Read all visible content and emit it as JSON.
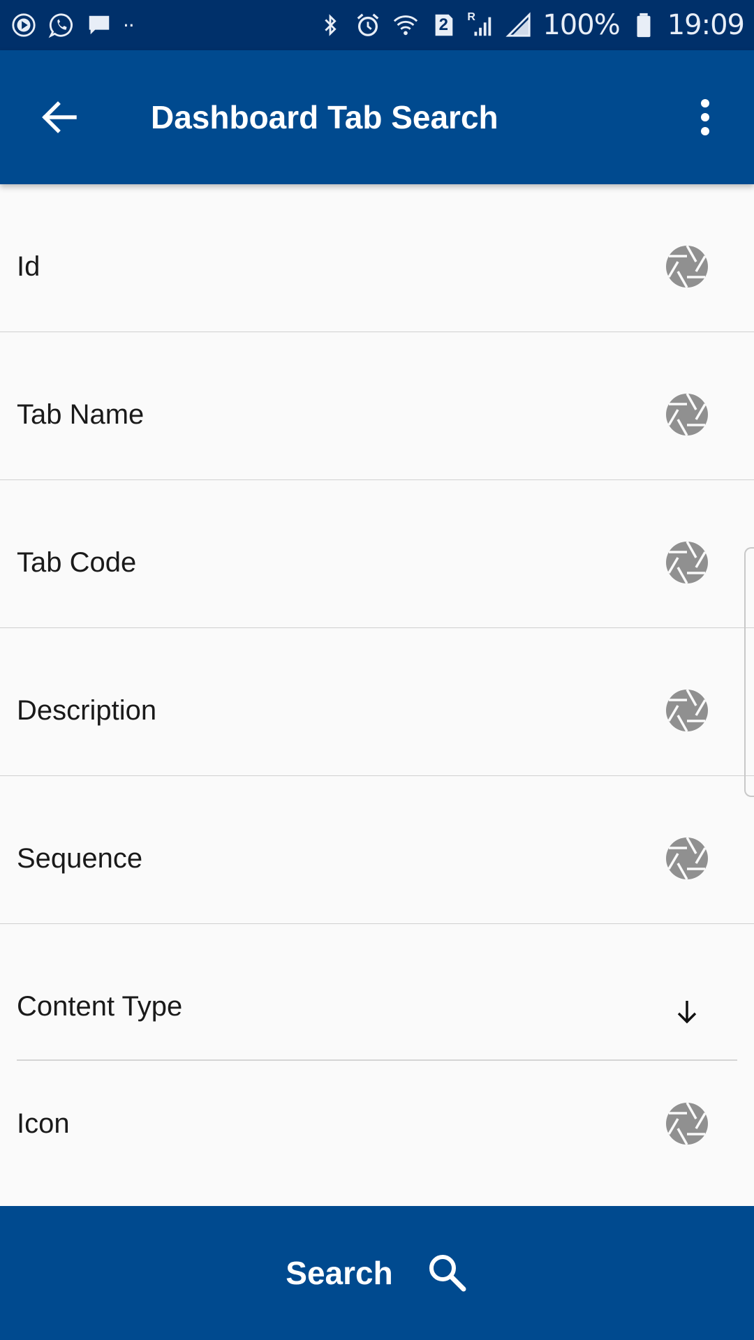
{
  "status_bar": {
    "battery_text": "100%",
    "time": "19:09",
    "sim_badge": "2",
    "roaming_mark": "R",
    "overflow_dots": "··",
    "left_icons": [
      "play-notification-icon",
      "whatsapp-icon",
      "message-icon"
    ],
    "right_icons": [
      "bluetooth-icon",
      "alarm-icon",
      "wifi-icon",
      "sim2-icon",
      "signal-roaming-icon",
      "signal-icon",
      "battery-icon"
    ]
  },
  "app_bar": {
    "title": "Dashboard Tab Search",
    "back_icon": "arrow-back-icon",
    "menu_icon": "more-vert-icon"
  },
  "fields": [
    {
      "label": "Id",
      "action_icon": "camera-aperture-icon"
    },
    {
      "label": "Tab Name",
      "action_icon": "camera-aperture-icon"
    },
    {
      "label": "Tab Code",
      "action_icon": "camera-aperture-icon"
    },
    {
      "label": "Description",
      "action_icon": "camera-aperture-icon"
    },
    {
      "label": "Sequence",
      "action_icon": "camera-aperture-icon"
    },
    {
      "label": "Content Type",
      "action_icon": "arrow-down-icon"
    },
    {
      "label": "Icon",
      "action_icon": "camera-aperture-icon"
    }
  ],
  "search_button": {
    "label": "Search",
    "icon": "search-icon"
  },
  "colors": {
    "status_bar": "#00306a",
    "primary": "#004a8f",
    "background": "#fafafa",
    "icon_gray": "#909090",
    "divider": "#d0d0d0"
  }
}
